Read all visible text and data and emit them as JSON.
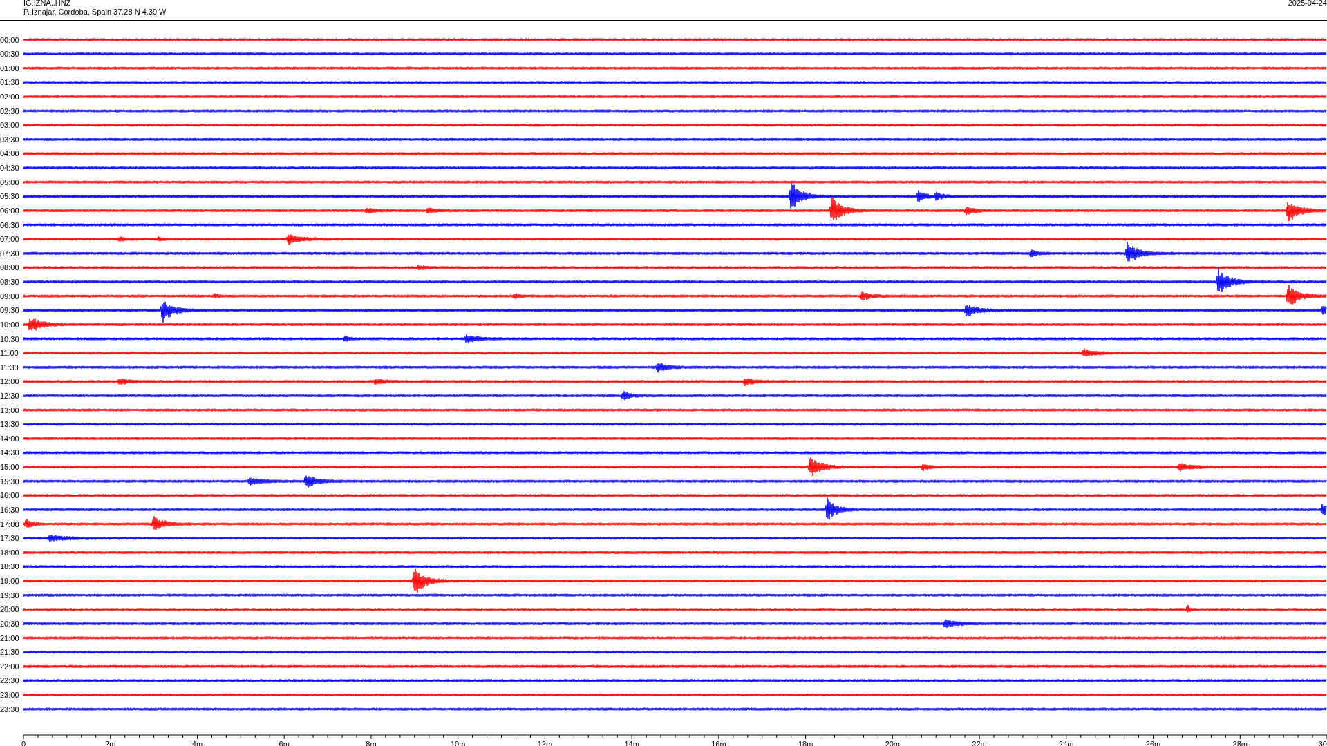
{
  "header": {
    "station": "IG.IZNA..HNZ",
    "location": "P. Iznajar, Cordoba, Spain  37.28 N 4.39 W",
    "date": "2025-04-24"
  },
  "helicorder": {
    "rows": [
      {
        "time": "00:00",
        "color": "#ff0000"
      },
      {
        "time": "00:30",
        "color": "#0000ff"
      },
      {
        "time": "01:00",
        "color": "#ff0000"
      },
      {
        "time": "01:30",
        "color": "#0000ff"
      },
      {
        "time": "02:00",
        "color": "#ff0000"
      },
      {
        "time": "02:30",
        "color": "#0000ff"
      },
      {
        "time": "03:00",
        "color": "#ff0000"
      },
      {
        "time": "03:30",
        "color": "#0000ff"
      },
      {
        "time": "04:00",
        "color": "#ff0000"
      },
      {
        "time": "04:30",
        "color": "#0000ff"
      },
      {
        "time": "05:00",
        "color": "#ff0000"
      },
      {
        "time": "05:30",
        "color": "#0000ff"
      },
      {
        "time": "06:00",
        "color": "#ff0000"
      },
      {
        "time": "06:30",
        "color": "#0000ff"
      },
      {
        "time": "07:00",
        "color": "#ff0000"
      },
      {
        "time": "07:30",
        "color": "#0000ff"
      },
      {
        "time": "08:00",
        "color": "#ff0000"
      },
      {
        "time": "08:30",
        "color": "#0000ff"
      },
      {
        "time": "09:00",
        "color": "#ff0000"
      },
      {
        "time": "09:30",
        "color": "#0000ff"
      },
      {
        "time": "10:00",
        "color": "#ff0000"
      },
      {
        "time": "10:30",
        "color": "#0000ff"
      },
      {
        "time": "11:00",
        "color": "#ff0000"
      },
      {
        "time": "11:30",
        "color": "#0000ff"
      },
      {
        "time": "12:00",
        "color": "#ff0000"
      },
      {
        "time": "12:30",
        "color": "#0000ff"
      },
      {
        "time": "13:00",
        "color": "#ff0000"
      },
      {
        "time": "13:30",
        "color": "#0000ff"
      },
      {
        "time": "14:00",
        "color": "#ff0000"
      },
      {
        "time": "14:30",
        "color": "#0000ff"
      },
      {
        "time": "15:00",
        "color": "#ff0000"
      },
      {
        "time": "15:30",
        "color": "#0000ff"
      },
      {
        "time": "16:00",
        "color": "#ff0000"
      },
      {
        "time": "16:30",
        "color": "#0000ff"
      },
      {
        "time": "17:00",
        "color": "#ff0000"
      },
      {
        "time": "17:30",
        "color": "#0000ff"
      },
      {
        "time": "18:00",
        "color": "#ff0000"
      },
      {
        "time": "18:30",
        "color": "#0000ff"
      },
      {
        "time": "19:00",
        "color": "#ff0000"
      },
      {
        "time": "19:30",
        "color": "#0000ff"
      },
      {
        "time": "20:00",
        "color": "#ff0000"
      },
      {
        "time": "20:30",
        "color": "#0000ff"
      },
      {
        "time": "21:00",
        "color": "#ff0000"
      },
      {
        "time": "21:30",
        "color": "#0000ff"
      },
      {
        "time": "22:00",
        "color": "#ff0000"
      },
      {
        "time": "22:30",
        "color": "#0000ff"
      },
      {
        "time": "23:00",
        "color": "#ff0000"
      },
      {
        "time": "23:30",
        "color": "#0000ff"
      }
    ],
    "x_axis_labels": [
      "0",
      "2m",
      "4m",
      "6m",
      "8m",
      "10m",
      "12m",
      "14m",
      "16m",
      "18m",
      "20m",
      "22m",
      "24m",
      "26m",
      "28m",
      "30"
    ]
  }
}
